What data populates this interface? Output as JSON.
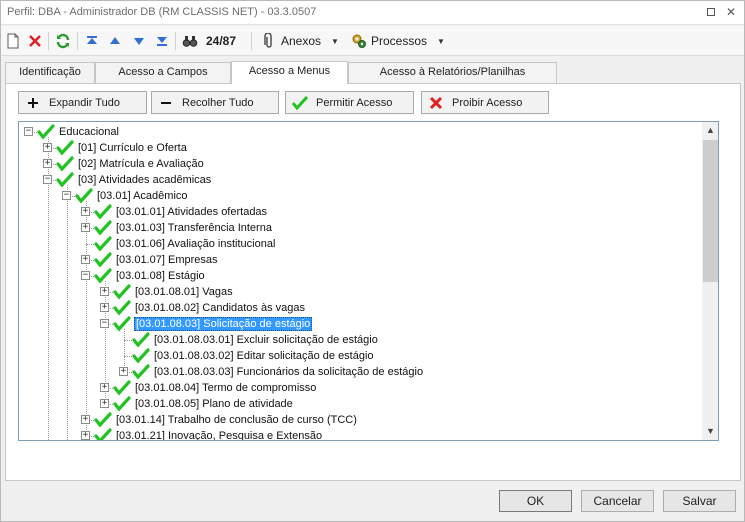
{
  "window": {
    "title": "Perfil: DBA - Administrador DB (RM CLASSIS NET) - 03.3.0507"
  },
  "toolbar": {
    "record_counter": "24/87",
    "attachments_label": "Anexos",
    "processes_label": "Processos"
  },
  "tabs": [
    {
      "label": "Identificação"
    },
    {
      "label": "Acesso a Campos"
    },
    {
      "label": "Acesso a Menus"
    },
    {
      "label": "Acesso à Relatórios/Planilhas"
    }
  ],
  "actions": {
    "expand_all": "Expandir Tudo",
    "collapse_all": "Recolher Tudo",
    "allow_access": "Permitir Acesso",
    "deny_access": "Proibir Acesso"
  },
  "tree": [
    {
      "label": "Educacional",
      "depth": 0,
      "state": "expanded"
    },
    {
      "label": "[01] Currículo e Oferta",
      "depth": 1,
      "state": "collapsed"
    },
    {
      "label": "[02] Matrícula e Avaliação",
      "depth": 1,
      "state": "collapsed"
    },
    {
      "label": "[03] Atividades acadêmicas",
      "depth": 1,
      "state": "expanded"
    },
    {
      "label": "[03.01] Acadêmico",
      "depth": 2,
      "state": "expanded"
    },
    {
      "label": "[03.01.01] Atividades ofertadas",
      "depth": 3,
      "state": "collapsed"
    },
    {
      "label": "[03.01.03] Transferência Interna",
      "depth": 3,
      "state": "collapsed"
    },
    {
      "label": "[03.01.06] Avaliação institucional",
      "depth": 3,
      "state": "leaf"
    },
    {
      "label": "[03.01.07] Empresas",
      "depth": 3,
      "state": "collapsed"
    },
    {
      "label": "[03.01.08] Estágio",
      "depth": 3,
      "state": "expanded"
    },
    {
      "label": "[03.01.08.01] Vagas",
      "depth": 4,
      "state": "collapsed"
    },
    {
      "label": "[03.01.08.02] Candidatos às vagas",
      "depth": 4,
      "state": "collapsed"
    },
    {
      "label": "[03.01.08.03] Solicitação de estágio",
      "depth": 4,
      "state": "expanded",
      "selected": true
    },
    {
      "label": "[03.01.08.03.01] Excluir solicitação de estágio",
      "depth": 5,
      "state": "leaf"
    },
    {
      "label": "[03.01.08.03.02] Editar solicitação de estágio",
      "depth": 5,
      "state": "leaf"
    },
    {
      "label": "[03.01.08.03.03] Funcionários da solicitação de estágio",
      "depth": 5,
      "state": "collapsed"
    },
    {
      "label": "[03.01.08.04] Termo de compromisso",
      "depth": 4,
      "state": "collapsed"
    },
    {
      "label": "[03.01.08.05] Plano de atividade",
      "depth": 4,
      "state": "collapsed"
    },
    {
      "label": "[03.01.14] Trabalho de conclusão de curso (TCC)",
      "depth": 3,
      "state": "collapsed"
    },
    {
      "label": "[03.01.21] Inovação, Pesquisa e Extensão",
      "depth": 3,
      "state": "collapsed"
    }
  ],
  "footer": {
    "ok": "OK",
    "cancel": "Cancelar",
    "save": "Salvar"
  },
  "colors": {
    "selection": "#3399ff",
    "check_green": "#1fc21f"
  }
}
